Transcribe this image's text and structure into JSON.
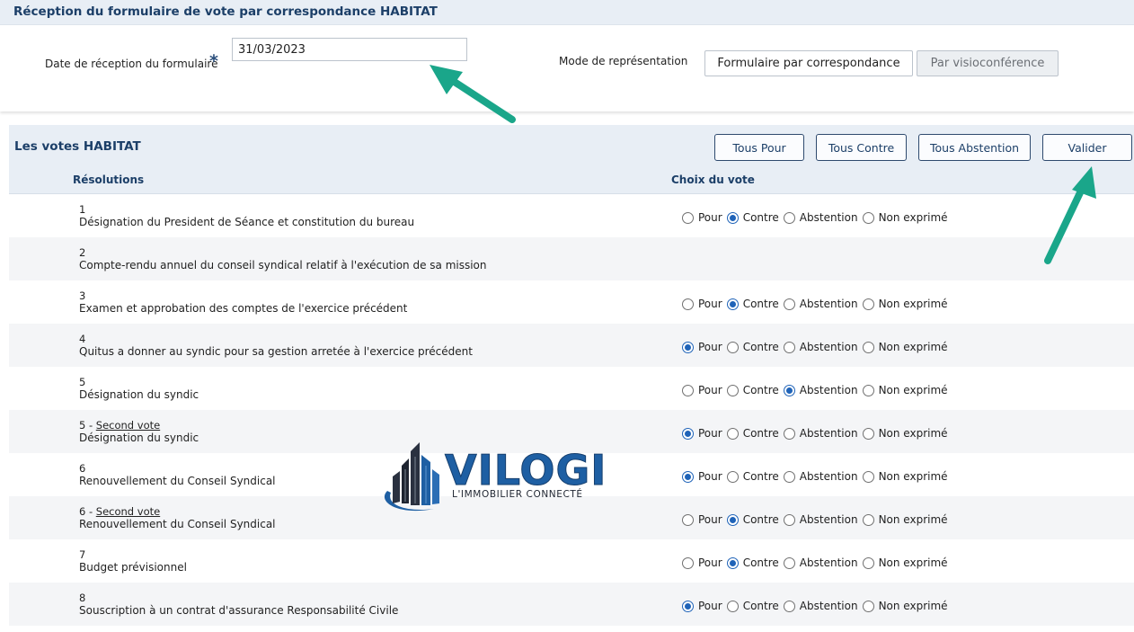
{
  "top": {
    "title": "Réception du formulaire de vote par correspondance HABITAT",
    "date_label": "Date de réception du formulaire",
    "required_mark": "*",
    "date_value": "31/03/2023",
    "mode_label": "Mode de représentation",
    "mode_correspondance": "Formulaire par correspondance",
    "mode_visio": "Par visioconférence"
  },
  "votes": {
    "title": "Les votes HABITAT",
    "buttons": {
      "tous_pour": "Tous Pour",
      "tous_contre": "Tous Contre",
      "tous_abstention": "Tous Abstention",
      "valider": "Valider"
    },
    "col_resolutions": "Résolutions",
    "col_choice": "Choix du vote",
    "option_labels": [
      "Pour",
      "Contre",
      "Abstention",
      "Non exprimé"
    ],
    "rows": [
      {
        "num": "1",
        "second": "",
        "title": "Désignation du President de Séance et constitution du bureau",
        "choice": "Contre"
      },
      {
        "num": "2",
        "second": "",
        "title": "Compte-rendu annuel du conseil syndical relatif à l'exécution de sa mission",
        "choice": ""
      },
      {
        "num": "3",
        "second": "",
        "title": "Examen et approbation des comptes de l'exercice précédent",
        "choice": "Contre"
      },
      {
        "num": "4",
        "second": "",
        "title": "Quitus a donner au syndic pour sa gestion arretée à l'exercice précédent",
        "choice": "Pour"
      },
      {
        "num": "5",
        "second": "",
        "title": "Désignation du syndic",
        "choice": "Abstention"
      },
      {
        "num": "5 - ",
        "second": "Second vote",
        "title": "Désignation du syndic",
        "choice": "Pour"
      },
      {
        "num": "6",
        "second": "",
        "title": "Renouvellement du Conseil Syndical",
        "choice": "Pour"
      },
      {
        "num": "6 - ",
        "second": "Second vote",
        "title": "Renouvellement du Conseil Syndical",
        "choice": "Contre"
      },
      {
        "num": "7",
        "second": "",
        "title": "Budget prévisionnel",
        "choice": "Contre"
      },
      {
        "num": "8",
        "second": "",
        "title": "Souscription à un contrat d'assurance Responsabilité Civile",
        "choice": "Pour"
      }
    ]
  },
  "logo": {
    "name": "VILOGI",
    "tagline": "L'IMMOBILIER CONNECTÉ"
  },
  "colors": {
    "header_bg": "#e8eef5",
    "title_text": "#1c3f68",
    "radio_checked": "#1f63b8",
    "arrow": "#1aa68a"
  }
}
